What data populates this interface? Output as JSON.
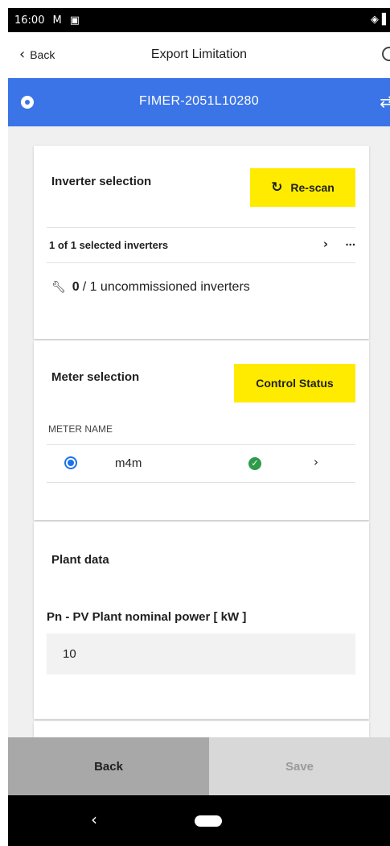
{
  "status_bar": {
    "time": "16:00",
    "mail_icon": "gmail-icon",
    "sim_icon": "sim-card-icon",
    "right_icons": "vibrate-icon"
  },
  "header": {
    "back_label": "Back",
    "title": "Export Limitation",
    "help_icon": "help-circle-icon"
  },
  "device_bar": {
    "name": "FIMER-2051L10280",
    "color": "#3b74e6"
  },
  "inverter_section": {
    "title": "Inverter selection",
    "rescan_label": "Re-scan",
    "selected_text": "1 of 1 selected inverters",
    "more": "...",
    "uncommissioned_count": "0",
    "uncommissioned_text": "/ 1 uncommissioned inverters"
  },
  "meter_section": {
    "title": "Meter selection",
    "control_status_label": "Control Status",
    "column_header": "METER NAME",
    "meters": [
      {
        "name": "m4m",
        "selected": true,
        "status": "ok"
      }
    ]
  },
  "plant_section": {
    "title": "Plant data",
    "pn_label": "Pn - PV Plant nominal power [ kW ]",
    "pn_value": "10"
  },
  "footer": {
    "back_label": "Back",
    "save_label": "Save"
  },
  "colors": {
    "accent_yellow": "#ffeb00",
    "ok_green": "#2e9b4b",
    "radio_blue": "#1a73e8"
  }
}
